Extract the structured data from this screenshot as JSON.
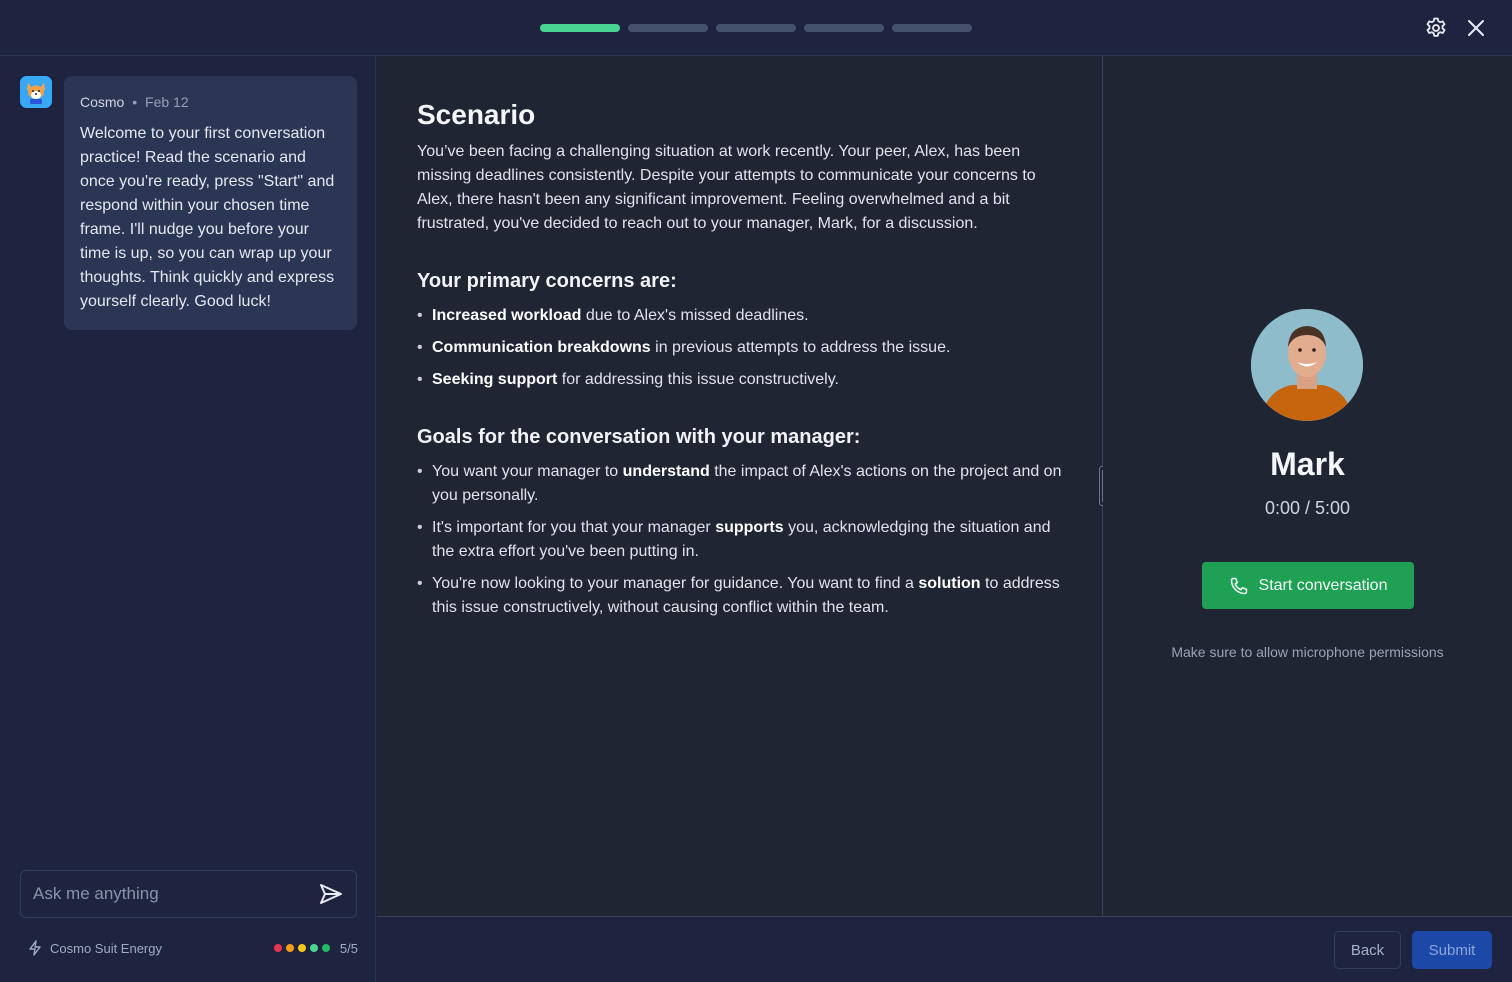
{
  "topbar": {
    "progress": {
      "total_steps": 5,
      "current_step": 1
    },
    "settings_icon": "gear-icon",
    "close_icon": "close-icon"
  },
  "sidebar": {
    "message": {
      "author": "Cosmo",
      "separator": "•",
      "date": "Feb 12",
      "text": "Welcome to your first conversation practice! Read the scenario and once you're ready, press \"Start\" and respond within your chosen time frame. I'll nudge you before your time is up, so you can wrap up your thoughts. Think quickly and express yourself clearly. Good luck!"
    },
    "ask_input": {
      "placeholder": "Ask me anything",
      "value": ""
    },
    "energy": {
      "label": "Cosmo Suit Energy",
      "value": "5/5",
      "dot_colors": [
        "#e8344f",
        "#f59c1a",
        "#f5c71a",
        "#4cd492",
        "#23b864"
      ]
    }
  },
  "main": {
    "title": "Scenario",
    "intro": "You’ve been facing a challenging situation at work recently. Your peer, Alex, has been missing deadlines consistently. Despite your attempts to communicate your concerns to Alex, there hasn't been any significant improvement. Feeling overwhelmed and a bit frustrated, you've decided to reach out to your manager, Mark, for a discussion.",
    "concerns_heading": "Your primary concerns are:",
    "concerns": [
      {
        "bold": "Increased workload",
        "rest": " due to Alex's missed deadlines."
      },
      {
        "bold": "Communication breakdowns",
        "rest": " in previous attempts to address the issue."
      },
      {
        "bold": "Seeking support",
        "rest": " for addressing this issue constructively."
      }
    ],
    "goals_heading": "Goals for the conversation with your manager:",
    "goals": [
      {
        "pre": "You want your manager to ",
        "bold": "understand",
        "post": " the impact of Alex's actions on the project and on you personally."
      },
      {
        "pre": "It's important for you that your manager ",
        "bold": "supports",
        "post": " you, acknowledging the situation and the extra effort you've been putting in."
      },
      {
        "pre": "You're now looking to your manager for guidance. You want to find a ",
        "bold": "solution",
        "post": " to address this issue constructively, without causing conflict within the team."
      }
    ]
  },
  "right_panel": {
    "person_name": "Mark",
    "timer": "0:00 / 5:00",
    "start_button": "Start conversation",
    "mic_note": "Make sure to allow microphone permissions"
  },
  "footer": {
    "back_label": "Back",
    "submit_label": "Submit"
  }
}
